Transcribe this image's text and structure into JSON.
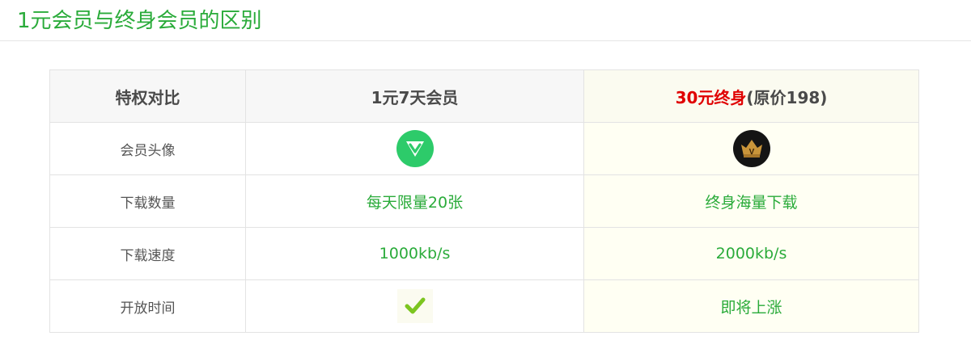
{
  "page": {
    "title": "1元会员与终身会员的区别"
  },
  "table": {
    "header": {
      "col0": "特权对比",
      "col1": "1元7天会员",
      "col2_price": "30元终身",
      "col2_orig": "(原价198)"
    },
    "rows": [
      {
        "label": "会员头像",
        "basic": "",
        "lifetime": ""
      },
      {
        "label": "下载数量",
        "basic": "每天限量20张",
        "lifetime": "终身海量下载"
      },
      {
        "label": "下载速度",
        "basic": "1000kb/s",
        "lifetime": "2000kb/s"
      },
      {
        "label": "开放时间",
        "basic": "",
        "lifetime": "即将上涨"
      }
    ],
    "icons": {
      "basic_avatar": "vip-badge-icon",
      "lifetime_avatar": "crown-badge-icon",
      "open_time_basic": "checkmark-icon"
    }
  },
  "colors": {
    "accent_green": "#2aab3a",
    "price_red": "#e00000",
    "lifetime_bg": "#fffff3"
  }
}
